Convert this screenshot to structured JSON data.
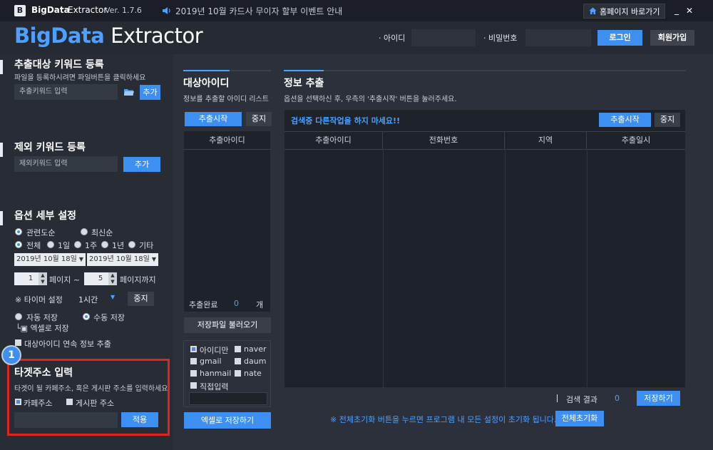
{
  "titlebar": {
    "logo_letter": "B",
    "app_name": "BigData",
    "app_name2": "Extractor",
    "version": "Ver. 1.7.6",
    "notice": "2019년 10월 카드사 무이자 할부 이벤트 안내",
    "home_label": "홈페이지 바로가기",
    "min_glyph": "_",
    "close_glyph": "✕"
  },
  "header": {
    "brand_big": "BigData",
    "brand_rest": " Extractor",
    "id_label": "· 아이디",
    "pw_label": "· 비밀번호",
    "login_label": "로그인",
    "signup_label": "회원가입"
  },
  "left": {
    "keyword_title": "추출대상 키워드 등록",
    "keyword_desc": "파일을 등록하시려면 파일버튼을 클릭하세요",
    "keyword_placeholder": "추출키워드 입력",
    "add_label": "추가",
    "exclude_title": "제외 키워드 등록",
    "exclude_placeholder": "제외키워드 입력",
    "exclude_add_label": "추가",
    "options_title": "옵션 세부 설정",
    "sort_relevance": "관련도순",
    "sort_latest": "최신순",
    "range_all": "전체",
    "range_1d": "1일",
    "range_1w": "1주",
    "range_1y": "1년",
    "range_etc": "기타",
    "date_from": "2019년 10월 18일",
    "date_to": "2019년 10월 18일",
    "page_from": "1",
    "page_mid": "페이지 ~",
    "page_to": "5",
    "page_end": "페이지까지",
    "timer_label": "※ 타이머 설정",
    "timer_value": "1시간",
    "timer_stop": "중지",
    "auto_save": "자동 저장",
    "manual_save": "수동 저장",
    "excel_save": "└▣ 엑셀로 저장",
    "continuous": "대상아이디 연속 정보 추출",
    "badge": "1",
    "target_title": "타겟주소 입력",
    "target_desc": "타겟이 될 카페주소, 혹은 게시판 주소를 입력하세요",
    "cafe_label": "카페주소",
    "board_label": "게시판 주소",
    "apply_label": "적용"
  },
  "middle": {
    "title": "대상아이디",
    "desc": "정보를 추출할 아이디 리스트",
    "start_label": "추출시작",
    "stop_label": "중지",
    "col_id": "추출아이디",
    "done_label": "추출완료",
    "done_count": "0",
    "done_unit": "개",
    "load_label": "저장파일 불러오기",
    "only_id": "아이디만",
    "naver": "naver",
    "gmail": "gmail",
    "daum": "daum",
    "hanmail": "hanmail",
    "nate": "nate",
    "direct": "직접입력",
    "excel_label": "엑셀로 저장하기"
  },
  "right": {
    "title": "정보 추출",
    "desc": "옵션을 선택하신 후, 우측의 '추출시작' 버튼을 눌러주세요.",
    "warning": "검색중 다른작업을 하지 마세요!!",
    "start_label": "추출시작",
    "stop_label": "중지",
    "columns": [
      "추출아이디",
      "전화번호",
      "지역",
      "추출일시"
    ],
    "result_label": "검색 결과",
    "result_count": "0",
    "save_label": "저장하기",
    "reset_notice": "※ 전체초기화 버튼을 누르면 프로그램 내 모든 설정이 초기화 됩니다.",
    "reset_label": "전체초기화"
  },
  "colors": {
    "accent": "#3d8ff1",
    "highlight": "#e02424",
    "background": "#252a33"
  }
}
